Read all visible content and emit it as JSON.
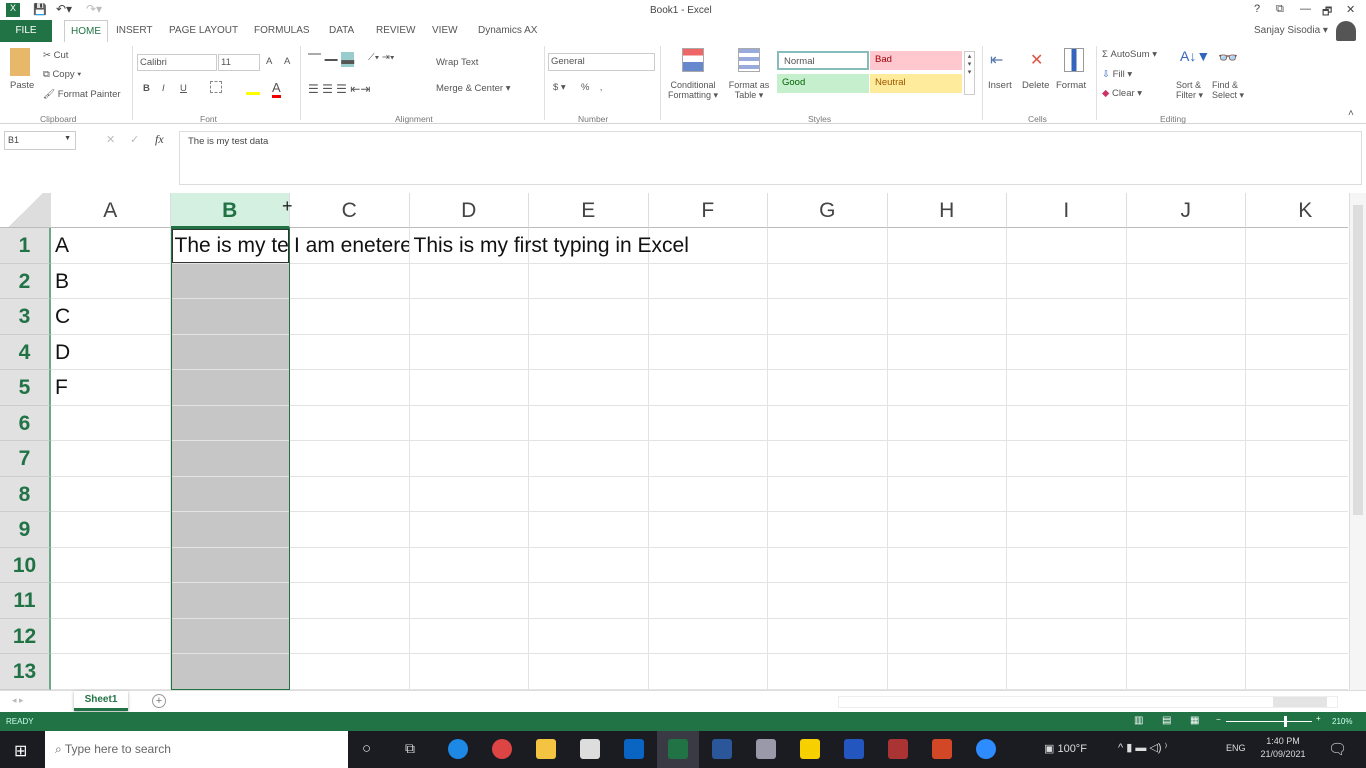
{
  "window": {
    "title": "Book1 - Excel",
    "user": "Sanjay Sisodia ▾",
    "controls": [
      "?",
      "⧉",
      "—",
      "🗗",
      "✕"
    ]
  },
  "quick_access": {
    "save": "save-icon",
    "undo": "undo-icon",
    "redo": "redo-icon"
  },
  "tabs": [
    "FILE",
    "HOME",
    "INSERT",
    "PAGE LAYOUT",
    "FORMULAS",
    "DATA",
    "REVIEW",
    "VIEW",
    "Dynamics AX"
  ],
  "active_tab": "HOME",
  "ribbon": {
    "clipboard": {
      "paste": "Paste",
      "cut": "Cut",
      "copy": "Copy ▾",
      "format_painter": "Format Painter",
      "label": "Clipboard"
    },
    "font": {
      "name": "Calibri",
      "size": "11",
      "bold": "B",
      "italic": "I",
      "underline": "U",
      "grow": "A",
      "shrink": "A",
      "color": "A",
      "label": "Font"
    },
    "alignment": {
      "wrap": "Wrap Text",
      "merge": "Merge & Center ▾",
      "label": "Alignment"
    },
    "number": {
      "format": "General",
      "currency": "$ ▾",
      "percent": "%",
      "comma": "‚",
      "label": "Number"
    },
    "styles": {
      "conditional": "Conditional Formatting ▾",
      "format_table": "Format as Table ▾",
      "normal": "Normal",
      "bad": "Bad",
      "good": "Good",
      "neutral": "Neutral",
      "label": "Styles"
    },
    "cells": {
      "insert": "Insert",
      "delete": "Delete",
      "format": "Format",
      "label": "Cells"
    },
    "editing": {
      "autosum": "Σ AutoSum ▾",
      "fill": "Fill ▾",
      "clear": "Clear ▾",
      "sort": "Sort & Filter ▾",
      "find": "Find & Select ▾",
      "label": "Editing"
    }
  },
  "formula_bar": {
    "name_box": "B1",
    "fx": "fx",
    "cancel": "✕",
    "enter": "✓",
    "value": "The is my test data"
  },
  "columns": [
    "A",
    "B",
    "C",
    "D",
    "E",
    "F",
    "G",
    "H",
    "I",
    "J",
    "K"
  ],
  "selected_column": "B",
  "rows": [
    "1",
    "2",
    "3",
    "4",
    "5",
    "6",
    "7",
    "8",
    "9",
    "10",
    "11",
    "12",
    "13"
  ],
  "cells": {
    "A1": "A",
    "A2": "B",
    "A3": "C",
    "A4": "D",
    "A5": "F",
    "B1": "The is my test data",
    "C1": "I am enetered",
    "D1": "This is my first typing in Excel"
  },
  "sheets": [
    "Sheet1"
  ],
  "status": {
    "mode": "READY",
    "zoom": "210%"
  },
  "taskbar": {
    "search_placeholder": "Type here to search",
    "weather": "100°F",
    "lang": "ENG",
    "time": "1:40 PM",
    "date": "21/09/2021"
  },
  "colors": {
    "excel_green": "#217346",
    "bad_bg": "#ffc7ce",
    "good_bg": "#c6efce",
    "neutral_bg": "#ffeb9c",
    "selection": "#c6c6c6"
  }
}
